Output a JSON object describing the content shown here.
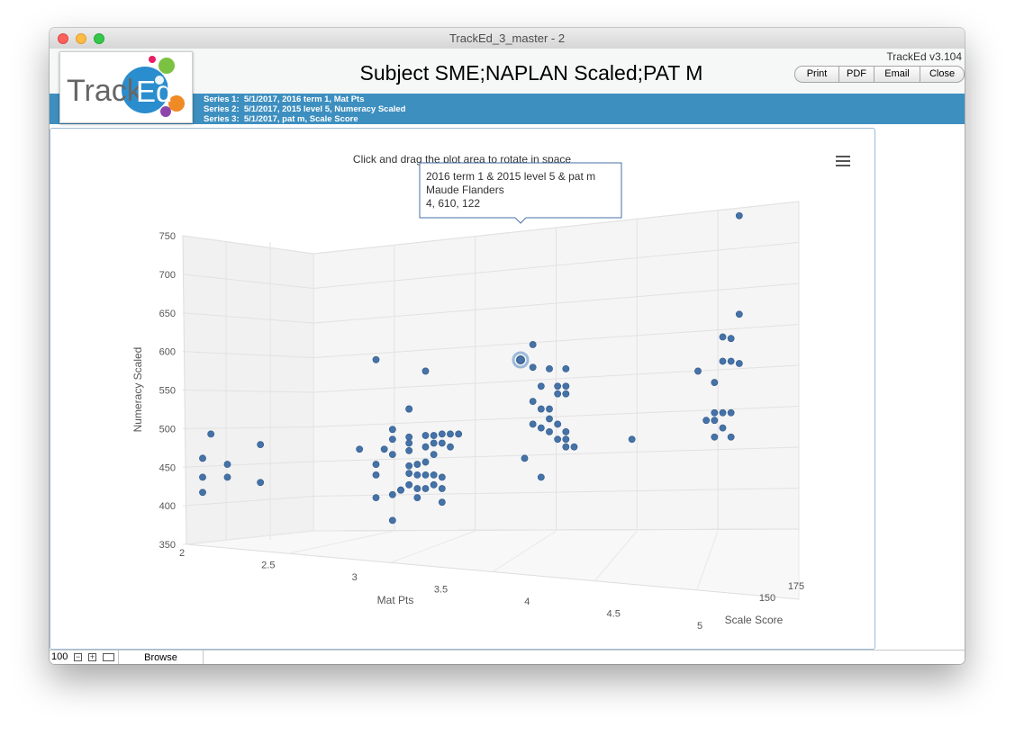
{
  "window": {
    "title": "TrackEd_3_master - 2"
  },
  "header": {
    "logo_text": "TrackEd",
    "title": "Subject SME;NAPLAN Scaled;PAT M",
    "version": "TrackEd v3.104",
    "buttons": [
      "Print",
      "PDF",
      "Email",
      "Close"
    ]
  },
  "series": [
    "Series 1:  5/1/2017, 2016 term 1, Mat Pts",
    "Series 2:  5/1/2017, 2015 level 5, Numeracy Scaled",
    "Series 3:  5/1/2017, pat m, Scale Score"
  ],
  "chart": {
    "subtitle": "Click and drag the plot area to rotate in space",
    "menu_icon": "hamburger-menu-icon",
    "tooltip": {
      "title": "2016 term 1 & 2015 level 5 & pat m",
      "name": "Maude Flanders",
      "values": "4, 610, 122"
    }
  },
  "chart_data": {
    "type": "scatter",
    "title": "",
    "subtitle": "Click and drag the plot area to rotate in space",
    "xlabel": "Mat Pts",
    "ylabel": "Numeracy Scaled",
    "zlabel": "Scale Score",
    "xlim": [
      2,
      5
    ],
    "ylim": [
      350,
      750
    ],
    "x_ticks": [
      "2",
      "2.5",
      "3",
      "3.5",
      "4",
      "4.5",
      "5"
    ],
    "y_ticks": [
      "350",
      "400",
      "450",
      "500",
      "550",
      "600",
      "650",
      "700",
      "750"
    ],
    "z_ticks": [
      "150",
      "175"
    ],
    "grid": true,
    "series": [
      {
        "name": "",
        "color": "#4572a7",
        "points": [
          [
            2.0,
            460
          ],
          [
            2.0,
            435
          ],
          [
            2.0,
            415
          ],
          [
            2.05,
            492
          ],
          [
            2.15,
            452
          ],
          [
            2.15,
            435
          ],
          [
            2.35,
            478
          ],
          [
            2.35,
            428
          ],
          [
            2.95,
            472
          ],
          [
            3.05,
            590
          ],
          [
            3.05,
            452
          ],
          [
            3.05,
            438
          ],
          [
            3.05,
            408
          ],
          [
            3.1,
            472
          ],
          [
            3.15,
            498
          ],
          [
            3.15,
            485
          ],
          [
            3.15,
            465
          ],
          [
            3.15,
            412
          ],
          [
            3.15,
            378
          ],
          [
            3.2,
            418
          ],
          [
            3.2,
            418
          ],
          [
            3.25,
            525
          ],
          [
            3.25,
            525
          ],
          [
            3.25,
            488
          ],
          [
            3.25,
            480
          ],
          [
            3.25,
            470
          ],
          [
            3.25,
            450
          ],
          [
            3.25,
            440
          ],
          [
            3.25,
            425
          ],
          [
            3.3,
            452
          ],
          [
            3.3,
            438
          ],
          [
            3.3,
            420
          ],
          [
            3.3,
            408
          ],
          [
            3.35,
            575
          ],
          [
            3.35,
            490
          ],
          [
            3.35,
            475
          ],
          [
            3.35,
            455
          ],
          [
            3.35,
            438
          ],
          [
            3.35,
            420
          ],
          [
            3.4,
            490
          ],
          [
            3.4,
            480
          ],
          [
            3.4,
            465
          ],
          [
            3.4,
            438
          ],
          [
            3.4,
            425
          ],
          [
            3.45,
            492
          ],
          [
            3.45,
            480
          ],
          [
            3.45,
            435
          ],
          [
            3.45,
            420
          ],
          [
            3.45,
            402
          ],
          [
            3.5,
            492
          ],
          [
            3.5,
            475
          ],
          [
            3.55,
            492
          ],
          [
            3.95,
            460
          ],
          [
            4.0,
            580
          ],
          [
            4.0,
            535
          ],
          [
            4.0,
            505
          ],
          [
            4.0,
            610
          ],
          [
            4.05,
            555
          ],
          [
            4.05,
            525
          ],
          [
            4.05,
            500
          ],
          [
            4.05,
            435
          ],
          [
            4.1,
            578
          ],
          [
            4.1,
            525
          ],
          [
            4.1,
            512
          ],
          [
            4.1,
            495
          ],
          [
            4.15,
            555
          ],
          [
            4.15,
            545
          ],
          [
            4.15,
            505
          ],
          [
            4.15,
            485
          ],
          [
            4.2,
            578
          ],
          [
            4.2,
            555
          ],
          [
            4.2,
            545
          ],
          [
            4.2,
            495
          ],
          [
            4.2,
            485
          ],
          [
            4.2,
            475
          ],
          [
            4.25,
            475
          ],
          [
            4.6,
            485
          ],
          [
            5.0,
            575
          ],
          [
            5.05,
            510
          ],
          [
            5.1,
            560
          ],
          [
            5.1,
            520
          ],
          [
            5.1,
            510
          ],
          [
            5.1,
            488
          ],
          [
            5.15,
            620
          ],
          [
            5.15,
            588
          ],
          [
            5.15,
            520
          ],
          [
            5.15,
            500
          ],
          [
            5.2,
            588
          ],
          [
            5.2,
            618
          ],
          [
            5.2,
            520
          ],
          [
            5.2,
            488
          ],
          [
            5.25,
            650
          ],
          [
            5.25,
            585
          ],
          [
            5.25,
            780
          ]
        ]
      }
    ]
  }
}
